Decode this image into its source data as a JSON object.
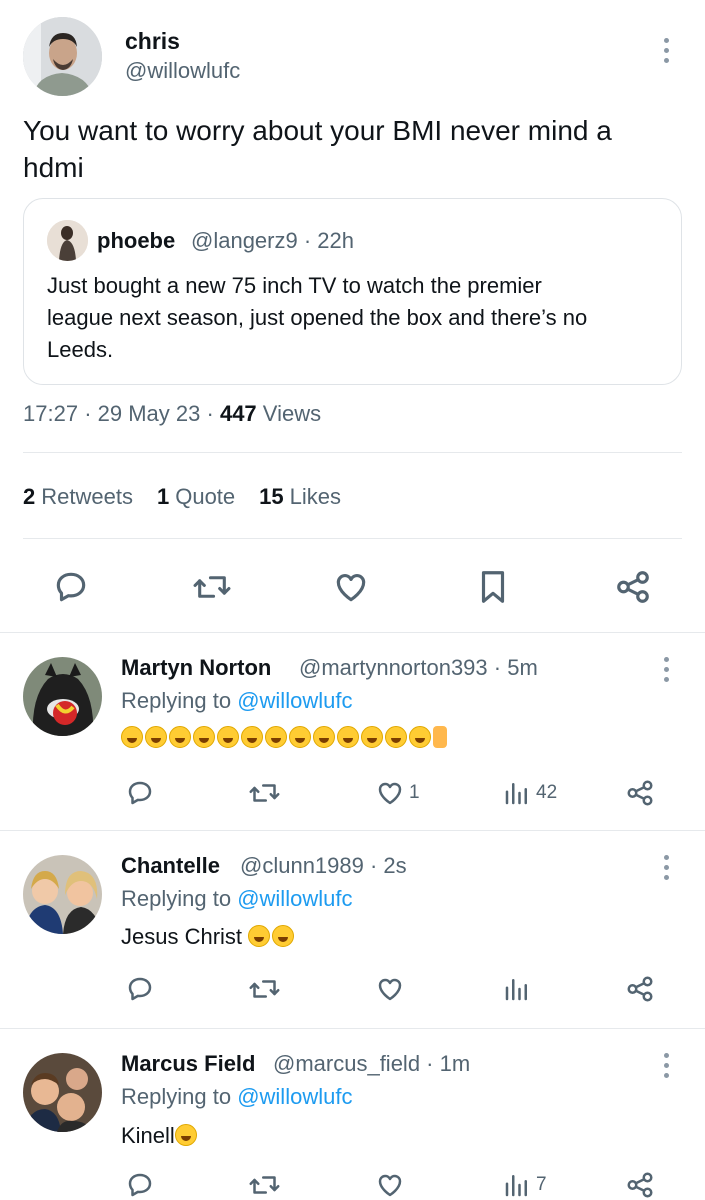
{
  "main_tweet": {
    "author_name": "chris",
    "author_handle": "@willowlufc",
    "text_line1": "You want to worry about your BMI never mind a",
    "text_line2": "hdmi",
    "quote": {
      "author_name": "phoebe",
      "author_handle_time": "@langerz9 · 22h",
      "text_line1": "Just bought a new 75 inch TV to watch the premier",
      "text_line2": "league next season, just opened the box  and there’s no",
      "text_line3": "Leeds."
    },
    "meta": {
      "time": "17:27",
      "date": "29 May 23",
      "views_count": "447",
      "views_label": "Views"
    },
    "stats": {
      "retweets_count": "2",
      "retweets_label": "Retweets",
      "quotes_count": "1",
      "quotes_label": "Quote",
      "likes_count": "15",
      "likes_label": "Likes"
    },
    "actions": [
      "reply-icon",
      "retweet-icon",
      "like-icon",
      "bookmark-icon",
      "share-icon"
    ]
  },
  "replies": [
    {
      "name": "Martyn Norton",
      "handle_time": "@martynnorton393 · 5m",
      "replying_prefix": "Replying to",
      "replying_handle": "@willowlufc",
      "text": "",
      "emoji_laugh_count": 13,
      "emoji_thumb": true,
      "likes": "1",
      "views": "42"
    },
    {
      "name": "Chantelle",
      "handle_time": "@clunn1989 · 2s",
      "replying_prefix": "Replying to",
      "replying_handle": "@willowlufc",
      "text": "Jesus Christ",
      "emoji_laugh_count": 2,
      "likes": "",
      "views": ""
    },
    {
      "name": "Marcus Field",
      "handle_time": "@marcus_field · 1m",
      "replying_prefix": "Replying to",
      "replying_handle": "@willowlufc",
      "text": "Kinell",
      "emoji_laugh_count": 1,
      "likes": "",
      "views": "7"
    }
  ],
  "colors": {
    "link": "#1d9bf0",
    "secondary_text": "#536471",
    "icon": "#536471",
    "divider": "#e6e9ec"
  }
}
